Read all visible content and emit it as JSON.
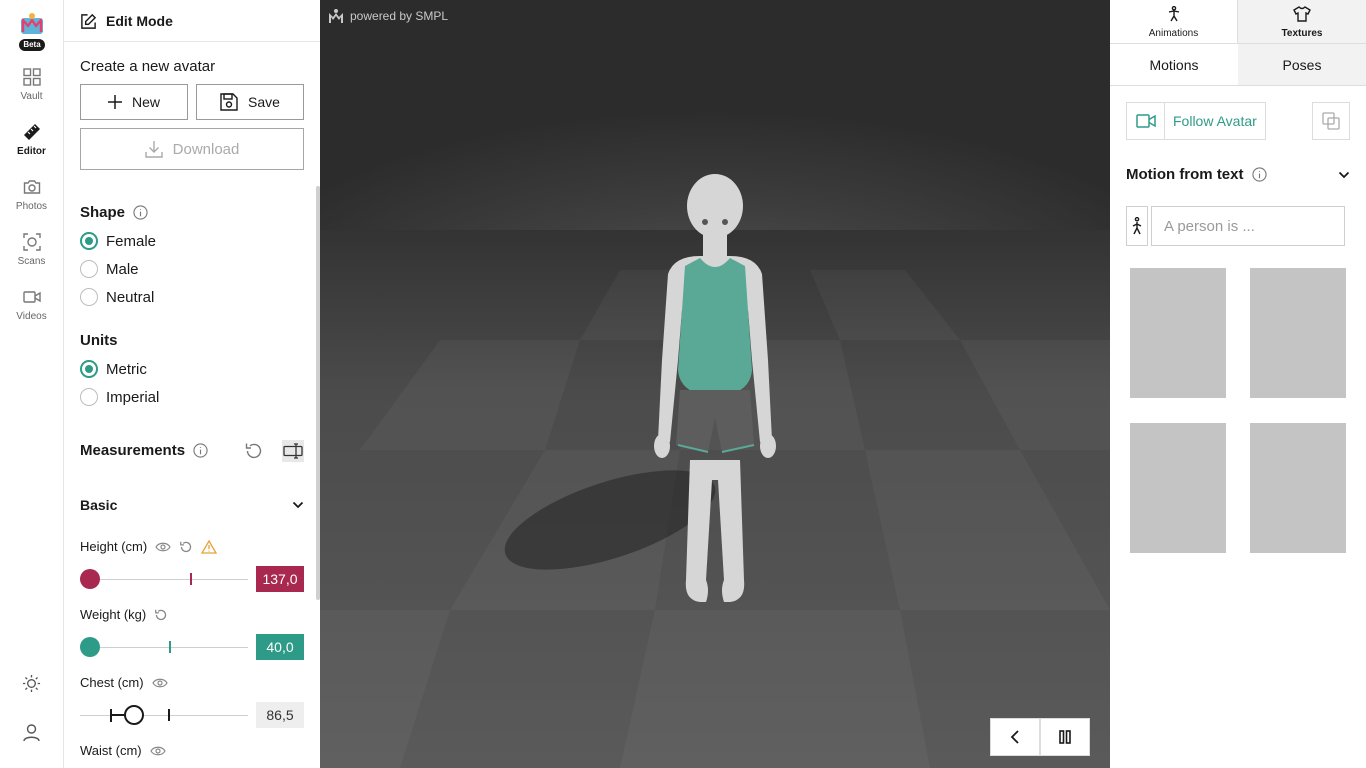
{
  "rail": {
    "beta": "Beta",
    "items": [
      {
        "label": "Vault",
        "icon": "grid-icon"
      },
      {
        "label": "Editor",
        "icon": "ruler-icon"
      },
      {
        "label": "Photos",
        "icon": "camera-icon"
      },
      {
        "label": "Scans",
        "icon": "scan-icon"
      },
      {
        "label": "Videos",
        "icon": "video-icon"
      }
    ]
  },
  "panel": {
    "edit_mode": "Edit Mode",
    "create_title": "Create a new avatar",
    "new_label": "New",
    "save_label": "Save",
    "download_label": "Download",
    "shape": {
      "title": "Shape",
      "options": [
        "Female",
        "Male",
        "Neutral"
      ],
      "selected": "Female"
    },
    "units": {
      "title": "Units",
      "options": [
        "Metric",
        "Imperial"
      ],
      "selected": "Metric"
    },
    "measurements_title": "Measurements",
    "basic_label": "Basic",
    "measurements": [
      {
        "label": "Height (cm)",
        "value": "137,0",
        "level": 0.0,
        "color": "#a8284f",
        "warning": true
      },
      {
        "label": "Weight (kg)",
        "value": "40,0",
        "level": 0.0,
        "color": "#2e9b88"
      },
      {
        "label": "Chest (cm)",
        "value": "86,5",
        "level": 0.3
      },
      {
        "label": "Waist (cm)"
      }
    ]
  },
  "viewport": {
    "powered_by": "powered by SMPL"
  },
  "right": {
    "tabs_top": [
      "Animations",
      "Textures"
    ],
    "active_top": "Textures",
    "tabs_sub": [
      "Motions",
      "Poses"
    ],
    "active_sub": "Motions",
    "follow_avatar": "Follow Avatar",
    "motion_from_text": "Motion from text",
    "prompt_placeholder": "A person is ..."
  },
  "colors": {
    "accent": "#2e9b88",
    "height_accent": "#a8284f"
  }
}
